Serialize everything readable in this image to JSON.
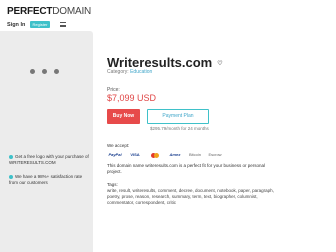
{
  "header": {
    "logo_bold": "PERFECT",
    "logo_light": "DOMAIN",
    "signin_label": "Sign In",
    "register_label": "Register"
  },
  "sidebar": {
    "notes": [
      "Get a free logo with your purchase of WRITERESULTS.COM",
      "We have a 98%+ satisfaction rate from our customers"
    ]
  },
  "domain": {
    "name": "Writeresults.com",
    "category_prefix": "Category:",
    "category": "Education",
    "price_label": "Price:",
    "price": "$7,099 USD",
    "buy_label": "Buy Now",
    "plan_label": "Payment Plan",
    "monthly_text": "$295.79/month for 24 months",
    "accept_label": "We accept:",
    "payments": [
      "PayPal",
      "VISA",
      "Mastercard",
      "Amex",
      "Bitcoin",
      "Escrow"
    ],
    "description": "This domain name writeresults.com is a perfect fit for your business or personal project.",
    "tags_label": "Tags:",
    "tags": "write, result, writeresults, comment, decree, document, notebook, paper, paragraph, poetry, prose, reason, research, summary, term, text, biographer, columnist, commentator, correspondent, critic"
  },
  "colors": {
    "accent": "#3fc1c9",
    "buy": "#e74a4a",
    "price": "#e04646"
  }
}
